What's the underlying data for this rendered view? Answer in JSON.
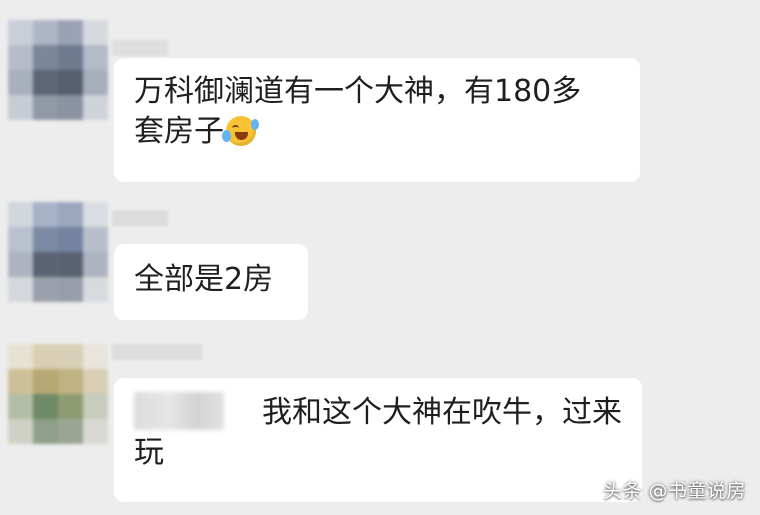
{
  "messages": [
    {
      "text": "万科御澜道有一个大神，有180多",
      "text_line2": "套房子",
      "emoji": "laughing-crying-emoji"
    },
    {
      "text": "全部是2房"
    },
    {
      "mention_hidden": true,
      "text": "我和这个大神在吹牛，过来",
      "text_line2": "玩"
    }
  ],
  "watermark": "头条 @书童说房",
  "colors": {
    "background": "#ededed",
    "bubble": "#ffffff",
    "text": "#1f1f1f"
  }
}
